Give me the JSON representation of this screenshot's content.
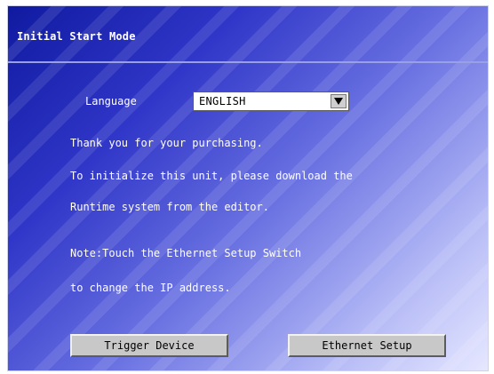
{
  "header": {
    "title": "Initial Start Mode"
  },
  "language": {
    "label": "Language",
    "selected": "ENGLISH",
    "arrow_icon": "triangle-down-icon"
  },
  "messages": {
    "line1": "Thank you for your purchasing.",
    "line2": "To initialize this unit, please download the",
    "line3": "Runtime system from the editor.",
    "line4": "Note:Touch the Ethernet Setup Switch",
    "line5": "to change the IP address."
  },
  "buttons": {
    "trigger_label": "Trigger Device",
    "ethernet_label": "Ethernet Setup"
  },
  "colors": {
    "background_dark": "#0f1aa0",
    "background_light": "#e6e8ff",
    "text": "#ffffff",
    "button_face": "#c8c8c8"
  }
}
